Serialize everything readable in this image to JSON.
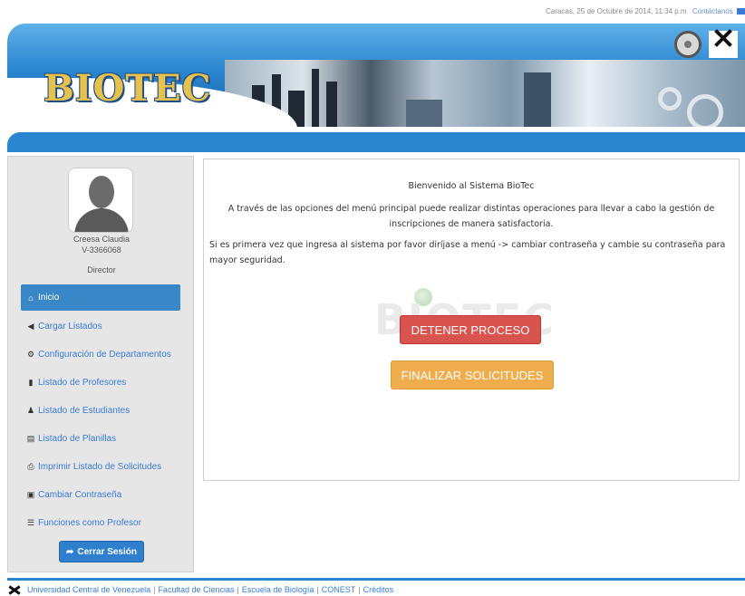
{
  "topbar": {
    "datetime": "Caracas, 25 de Octubre de 2014, 11:34 p.m",
    "contact": "Contáctanos"
  },
  "header": {
    "logo": "BIOTEC"
  },
  "user": {
    "name": "Creesa Claudia",
    "id": "V-3366068",
    "role": "Director"
  },
  "menu": {
    "items": [
      {
        "label": "Inicio",
        "icon": "home-icon",
        "active": true
      },
      {
        "label": "Cargar Listados",
        "icon": "send-icon"
      },
      {
        "label": "Configuración de Departamentos",
        "icon": "gear-icon"
      },
      {
        "label": "Listado de Profesores",
        "icon": "book-icon"
      },
      {
        "label": "Listado de Estudiantes",
        "icon": "user-icon"
      },
      {
        "label": "Listado de Planillas",
        "icon": "list-icon"
      },
      {
        "label": "Imprimir Listado de Solicitudes",
        "icon": "print-icon"
      },
      {
        "label": "Cambiar Contraseña",
        "icon": "lock-icon"
      },
      {
        "label": "Funciones como Profesor",
        "icon": "th-list-icon"
      }
    ],
    "logout": "Cerrar Sesión"
  },
  "main": {
    "welcome": "Bienvenido al Sistema BioTec",
    "description": "A través de las opciones del menú principal puede realizar distintas operaciones para llevar a cabo la gestión de inscripciones de manera satisfactoria.",
    "note": "Si es primera vez que ingresa al sistema por favor diríjase a menú -> cambiar contraseña y cambie su contraseña para mayor seguridad.",
    "watermark": "BIOTEC",
    "stop_button": "DETENER PROCESO",
    "finish_button": "FINALIZAR SOLICITUDES"
  },
  "footer": {
    "links": [
      "Universidad Central de Venezuela",
      "Facultad de Ciencias",
      "Escuela de Biología",
      "CONEST",
      "Créditos"
    ]
  },
  "colors": {
    "primary": "#2a86cf",
    "danger": "#d9534f",
    "warning": "#f0ad4e"
  }
}
